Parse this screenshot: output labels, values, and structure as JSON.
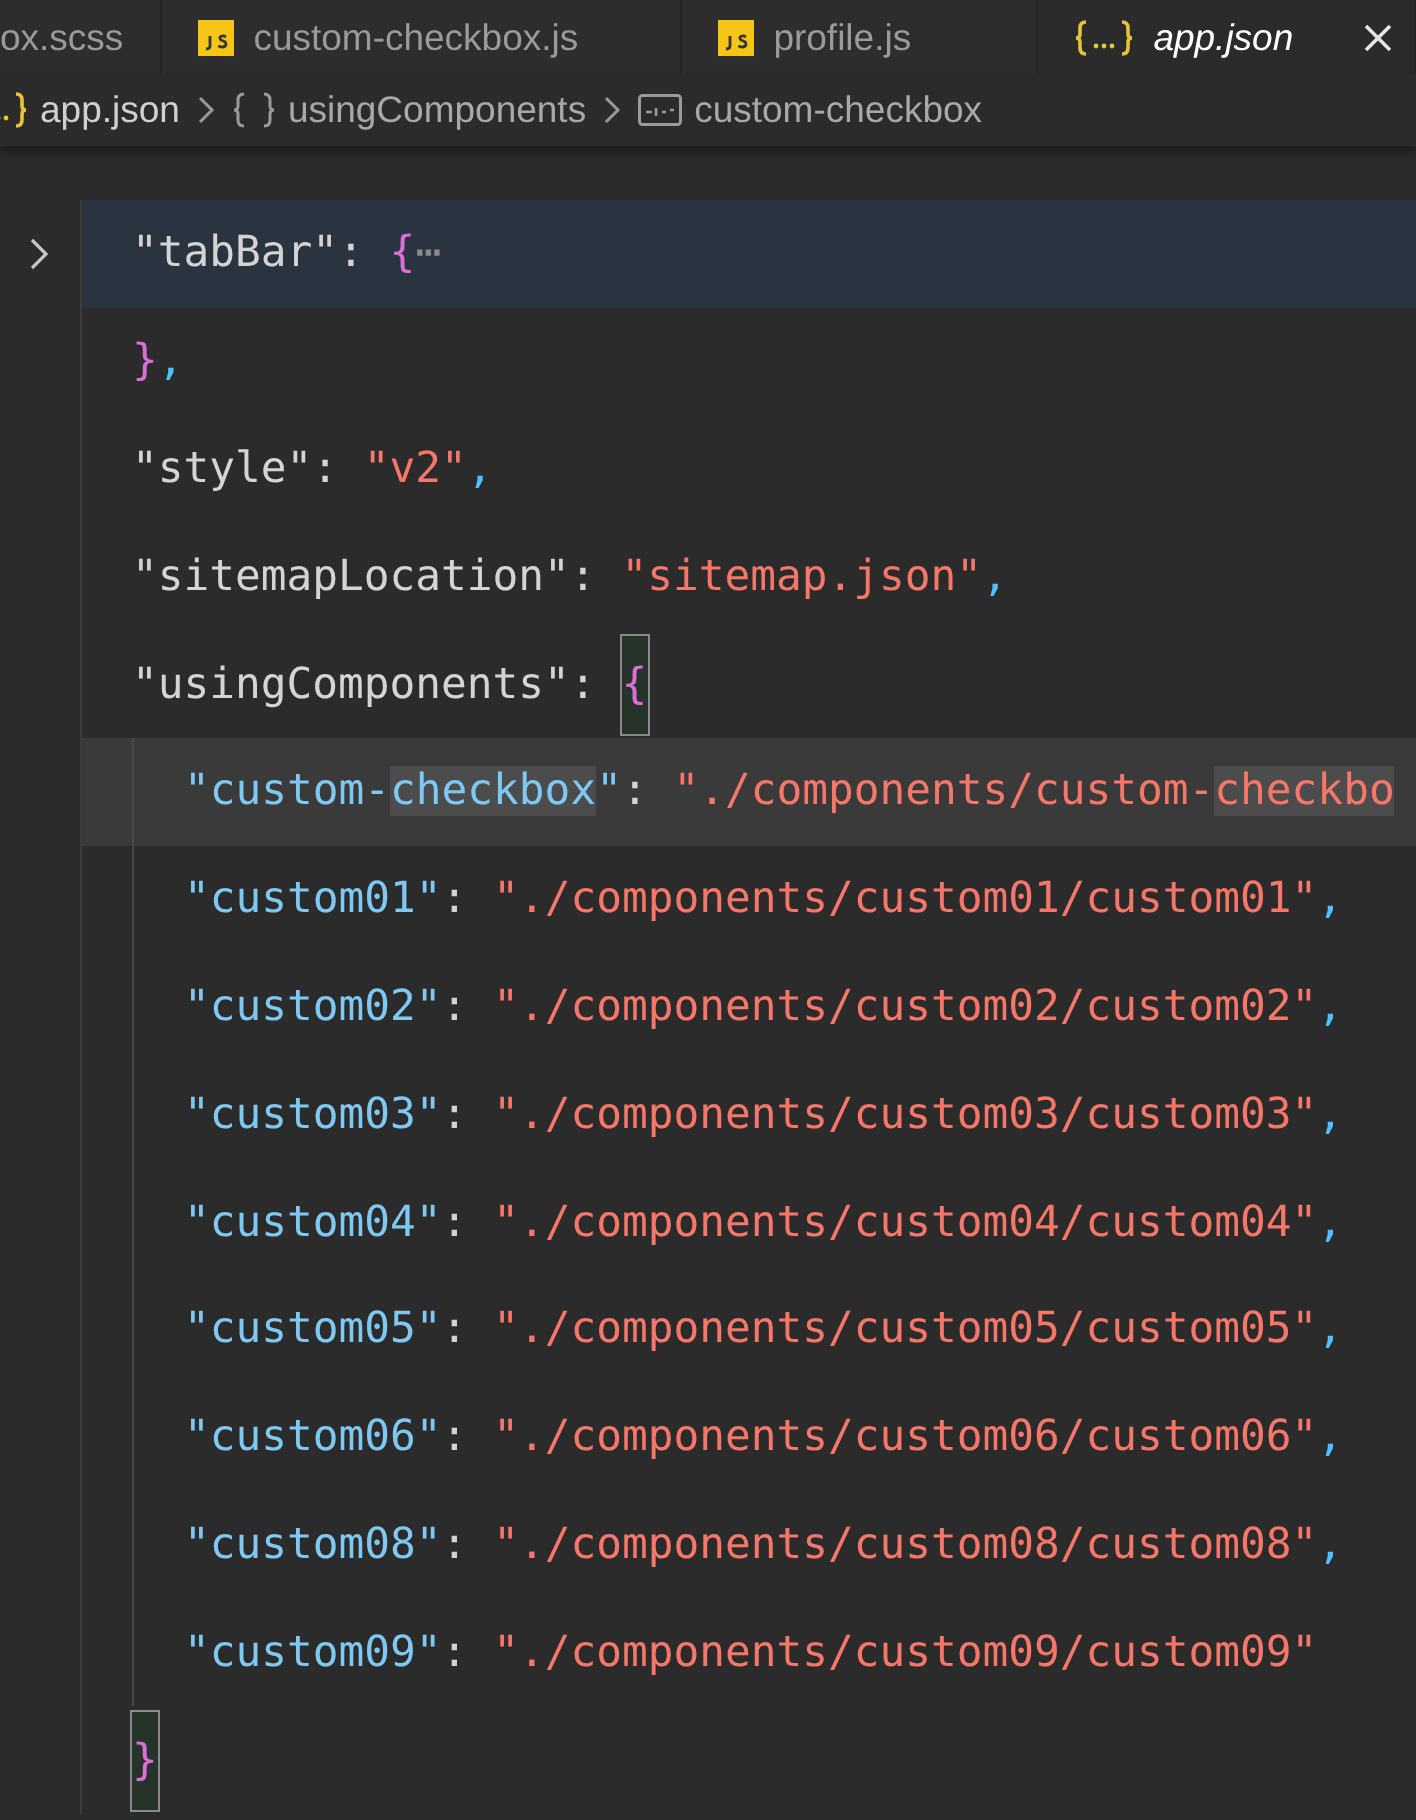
{
  "tabs": [
    {
      "label": "ox.scss",
      "kind": "style",
      "selected": false
    },
    {
      "label": "custom-checkbox.js",
      "kind": "script",
      "selected": false
    },
    {
      "label": "profile.js",
      "kind": "script",
      "selected": false
    },
    {
      "label": "app.json",
      "kind": "data",
      "selected": true
    }
  ],
  "breadcrumb": [
    {
      "kind": "file",
      "label": "app.json"
    },
    {
      "kind": "object",
      "label": "usingComponents"
    },
    {
      "kind": "string",
      "label": "custom-checkbox"
    }
  ],
  "lines": [
    {
      "selected": false,
      "folded": true,
      "tokens": [
        {
          "kind": "key",
          "text": "\"tabBar\""
        },
        {
          "kind": "colon",
          "text": ": "
        },
        {
          "kind": "bracket",
          "text": "{"
        },
        {
          "kind": "ellipsis",
          "text": "⋯"
        }
      ]
    },
    {
      "selected": false,
      "tokens": [
        {
          "kind": "bracket",
          "text": "}"
        },
        {
          "kind": "comma",
          "text": ","
        }
      ]
    },
    {
      "selected": false,
      "tokens": [
        {
          "kind": "key",
          "text": "\"style\""
        },
        {
          "kind": "colon",
          "text": ": "
        },
        {
          "kind": "string",
          "text": "\"v2\""
        },
        {
          "kind": "comma",
          "text": ","
        }
      ]
    },
    {
      "selected": false,
      "tokens": [
        {
          "kind": "key",
          "text": "\"sitemapLocation\""
        },
        {
          "kind": "colon",
          "text": ": "
        },
        {
          "kind": "string",
          "text": "\"sitemap.json\""
        },
        {
          "kind": "comma",
          "text": ","
        }
      ]
    },
    {
      "selected": false,
      "tokens": [
        {
          "kind": "key",
          "text": "\"usingComponents\""
        },
        {
          "kind": "colon",
          "text": ": "
        },
        {
          "kind": "bracket",
          "text": "{",
          "matched": true
        }
      ],
      "children": [
        {
          "selected": true,
          "tokens": [
            {
              "kind": "key",
              "text": "\"custom-"
            },
            {
              "kind": "key",
              "text": "checkbox",
              "highlight": true
            },
            {
              "kind": "key",
              "text": "\""
            },
            {
              "kind": "colon",
              "text": ": "
            },
            {
              "kind": "string",
              "text": "\"./components/custom-"
            },
            {
              "kind": "string",
              "text": "checkbo",
              "highlight": true
            }
          ]
        },
        {
          "selected": false,
          "tokens": [
            {
              "kind": "key",
              "text": "\"custom01\""
            },
            {
              "kind": "colon",
              "text": ": "
            },
            {
              "kind": "string",
              "text": "\"./components/custom01/custom01\""
            },
            {
              "kind": "comma",
              "text": ","
            }
          ]
        },
        {
          "selected": false,
          "tokens": [
            {
              "kind": "key",
              "text": "\"custom02\""
            },
            {
              "kind": "colon",
              "text": ": "
            },
            {
              "kind": "string",
              "text": "\"./components/custom02/custom02\""
            },
            {
              "kind": "comma",
              "text": ","
            }
          ]
        },
        {
          "selected": false,
          "tokens": [
            {
              "kind": "key",
              "text": "\"custom03\""
            },
            {
              "kind": "colon",
              "text": ": "
            },
            {
              "kind": "string",
              "text": "\"./components/custom03/custom03\""
            },
            {
              "kind": "comma",
              "text": ","
            }
          ]
        },
        {
          "selected": false,
          "tokens": [
            {
              "kind": "key",
              "text": "\"custom04\""
            },
            {
              "kind": "colon",
              "text": ": "
            },
            {
              "kind": "string",
              "text": "\"./components/custom04/custom04\""
            },
            {
              "kind": "comma",
              "text": ","
            }
          ]
        },
        {
          "selected": false,
          "tokens": [
            {
              "kind": "key",
              "text": "\"custom05\""
            },
            {
              "kind": "colon",
              "text": ": "
            },
            {
              "kind": "string",
              "text": "\"./components/custom05/custom05\""
            },
            {
              "kind": "comma",
              "text": ","
            }
          ]
        },
        {
          "selected": false,
          "tokens": [
            {
              "kind": "key",
              "text": "\"custom06\""
            },
            {
              "kind": "colon",
              "text": ": "
            },
            {
              "kind": "string",
              "text": "\"./components/custom06/custom06\""
            },
            {
              "kind": "comma",
              "text": ","
            }
          ]
        },
        {
          "selected": false,
          "tokens": [
            {
              "kind": "key",
              "text": "\"custom08\""
            },
            {
              "kind": "colon",
              "text": ": "
            },
            {
              "kind": "string",
              "text": "\"./components/custom08/custom08\""
            },
            {
              "kind": "comma",
              "text": ","
            }
          ]
        },
        {
          "selected": false,
          "tokens": [
            {
              "kind": "key",
              "text": "\"custom09\""
            },
            {
              "kind": "colon",
              "text": ": "
            },
            {
              "kind": "string",
              "text": "\"./components/custom09/custom09\""
            }
          ]
        }
      ]
    },
    {
      "selected": false,
      "tokens": [
        {
          "kind": "bracket",
          "text": "}",
          "matched": true
        }
      ]
    }
  ]
}
